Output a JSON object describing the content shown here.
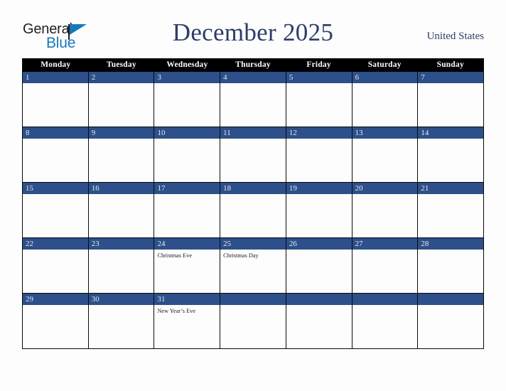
{
  "logo": {
    "word_top": "General",
    "word_bottom": "Blue",
    "triangle_color": "#1578be",
    "text_color": "#231f20"
  },
  "header": {
    "title": "December 2025",
    "country": "United States",
    "title_color": "#2c3e66"
  },
  "colors": {
    "day_header_bg": "#000000",
    "day_header_text": "#ffffff",
    "date_band_bg": "#2d4f8a",
    "date_number_text": "#e8eaee",
    "cell_bg": "#fdfdfd",
    "grid_line": "#0a0a0a",
    "page_bg": "#fdfdfd"
  },
  "weekday_headers": [
    "Monday",
    "Tuesday",
    "Wednesday",
    "Thursday",
    "Friday",
    "Saturday",
    "Sunday"
  ],
  "weeks": [
    [
      {
        "date": "1",
        "events": []
      },
      {
        "date": "2",
        "events": []
      },
      {
        "date": "3",
        "events": []
      },
      {
        "date": "4",
        "events": []
      },
      {
        "date": "5",
        "events": []
      },
      {
        "date": "6",
        "events": []
      },
      {
        "date": "7",
        "events": []
      }
    ],
    [
      {
        "date": "8",
        "events": []
      },
      {
        "date": "9",
        "events": []
      },
      {
        "date": "10",
        "events": []
      },
      {
        "date": "11",
        "events": []
      },
      {
        "date": "12",
        "events": []
      },
      {
        "date": "13",
        "events": []
      },
      {
        "date": "14",
        "events": []
      }
    ],
    [
      {
        "date": "15",
        "events": []
      },
      {
        "date": "16",
        "events": []
      },
      {
        "date": "17",
        "events": []
      },
      {
        "date": "18",
        "events": []
      },
      {
        "date": "19",
        "events": []
      },
      {
        "date": "20",
        "events": []
      },
      {
        "date": "21",
        "events": []
      }
    ],
    [
      {
        "date": "22",
        "events": []
      },
      {
        "date": "23",
        "events": []
      },
      {
        "date": "24",
        "events": [
          "Christmas Eve"
        ]
      },
      {
        "date": "25",
        "events": [
          "Christmas Day"
        ]
      },
      {
        "date": "26",
        "events": []
      },
      {
        "date": "27",
        "events": []
      },
      {
        "date": "28",
        "events": []
      }
    ],
    [
      {
        "date": "29",
        "events": []
      },
      {
        "date": "30",
        "events": []
      },
      {
        "date": "31",
        "events": [
          "New Year’s Eve"
        ]
      },
      {
        "date": "",
        "events": []
      },
      {
        "date": "",
        "events": []
      },
      {
        "date": "",
        "events": []
      },
      {
        "date": "",
        "events": []
      }
    ]
  ]
}
